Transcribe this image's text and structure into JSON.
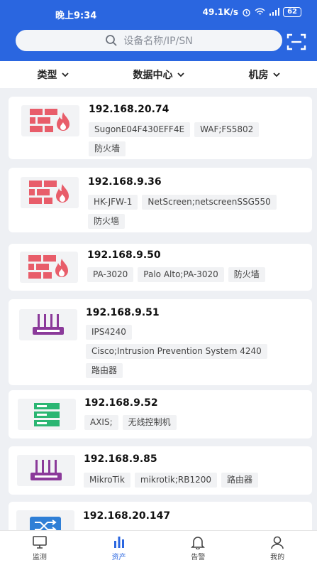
{
  "status": {
    "time": "晚上9:34",
    "speed": "49.1K/s",
    "battery": "62"
  },
  "search": {
    "placeholder": "设备名称/IP/SN"
  },
  "filters": [
    {
      "label": "类型"
    },
    {
      "label": "数据中心"
    },
    {
      "label": "机房"
    }
  ],
  "devices": [
    {
      "icon": "firewall-icon",
      "ip": "192.168.20.74",
      "tags": [
        "SugonE04F430EFF4E",
        "WAF;FS5802",
        "防火墙"
      ]
    },
    {
      "icon": "firewall-icon",
      "ip": "192.168.9.36",
      "tags": [
        "HK-JFW-1",
        "NetScreen;netscreenSSG550",
        "防火墙"
      ]
    },
    {
      "icon": "firewall-icon",
      "ip": "192.168.9.50",
      "tags": [
        "PA-3020",
        "Palo Alto;PA-3020",
        "防火墙"
      ]
    },
    {
      "icon": "router-icon",
      "ip": "192.168.9.51",
      "tags": [
        "IPS4240",
        "Cisco;Intrusion Prevention System 4240",
        "路由器"
      ]
    },
    {
      "icon": "controller-icon",
      "ip": "192.168.9.52",
      "tags": [
        "AXIS;",
        "无线控制机"
      ]
    },
    {
      "icon": "router-icon",
      "ip": "192.168.9.85",
      "tags": [
        "MikroTik",
        "mikrotik;RB1200",
        "路由器"
      ]
    },
    {
      "icon": "switch-icon",
      "ip": "192.168.20.147",
      "tags": []
    }
  ],
  "tabs": [
    {
      "label": "监测",
      "icon": "monitor-icon"
    },
    {
      "label": "资产",
      "icon": "asset-chart-icon"
    },
    {
      "label": "告警",
      "icon": "bell-icon"
    },
    {
      "label": "我的",
      "icon": "user-icon"
    }
  ],
  "colors": {
    "accent": "#2a66e0",
    "firewall": "#e85d6a",
    "router": "#8b3a9a",
    "controller": "#2bb673",
    "switch": "#2f7fd6"
  }
}
